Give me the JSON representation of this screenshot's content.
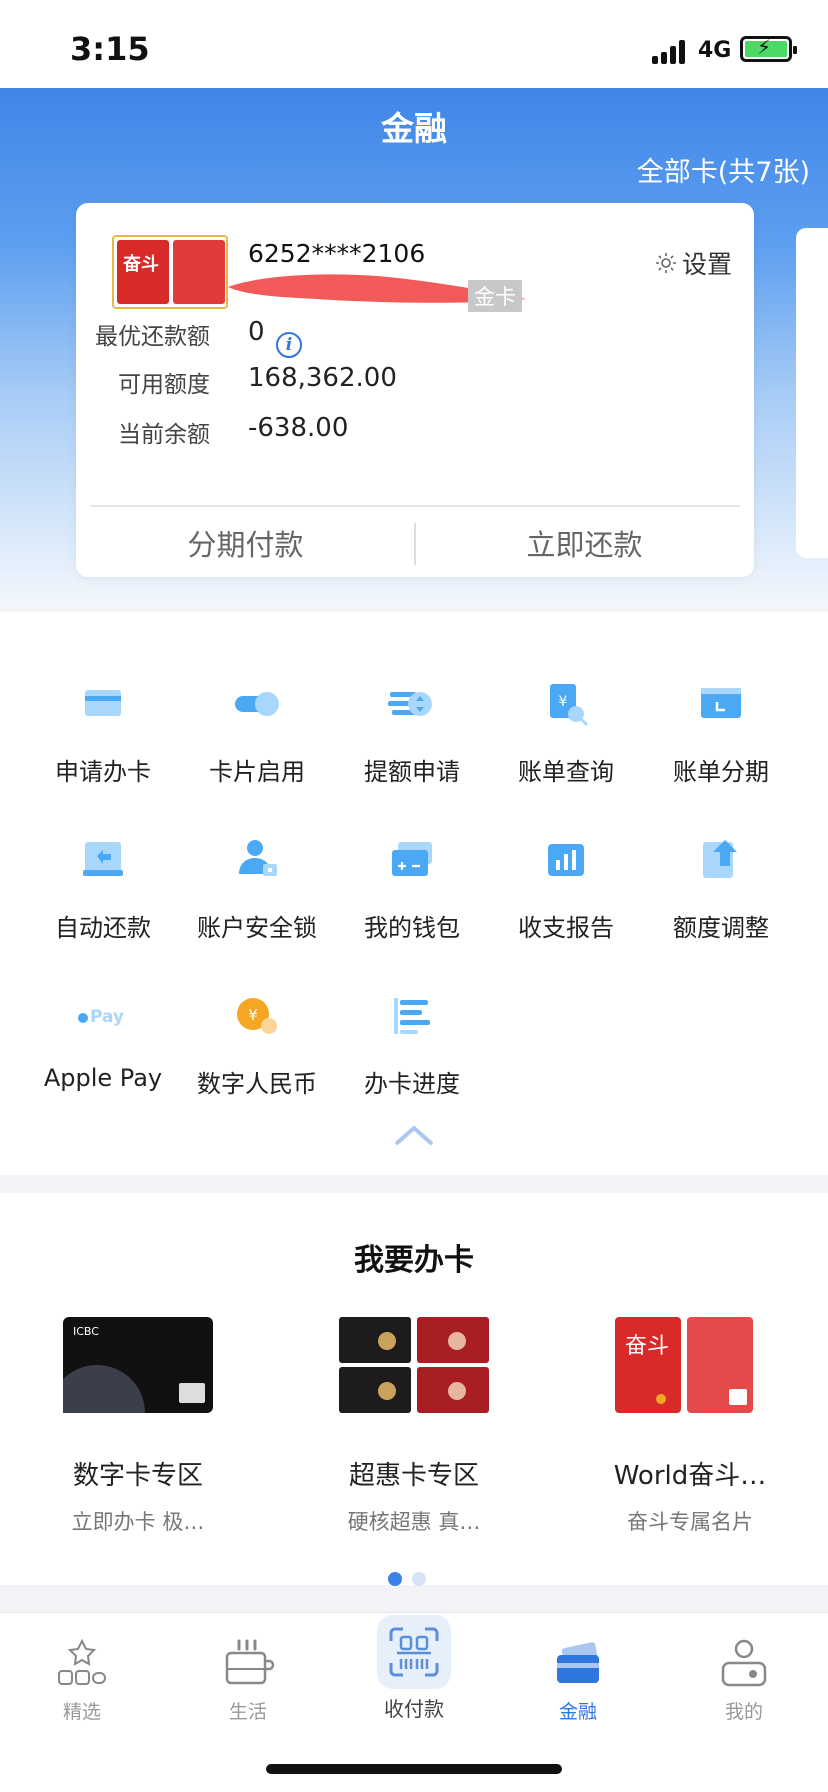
{
  "status_bar": {
    "time": "3:15",
    "network": "4G"
  },
  "header": {
    "title": "金融",
    "all_cards": "全部卡(共7张)"
  },
  "card_panel": {
    "card_number": "6252****2106",
    "card_level": "金卡",
    "settings_label": "设置",
    "rows": [
      {
        "label": "最优还款额",
        "value": "0"
      },
      {
        "label": "可用额度",
        "value": "168,362.00"
      },
      {
        "label": "当前余额",
        "value": "-638.00"
      }
    ],
    "installment_label": "分期付款",
    "repay_label": "立即还款"
  },
  "menu": {
    "items": [
      {
        "label": "申请办卡",
        "icon": "card-apply-icon"
      },
      {
        "label": "卡片启用",
        "icon": "toggle-icon"
      },
      {
        "label": "提额申请",
        "icon": "limit-up-icon"
      },
      {
        "label": "账单查询",
        "icon": "bill-search-icon"
      },
      {
        "label": "账单分期",
        "icon": "bill-installment-icon"
      },
      {
        "label": "自动还款",
        "icon": "auto-repay-icon"
      },
      {
        "label": "账户安全锁",
        "icon": "security-lock-icon"
      },
      {
        "label": "我的钱包",
        "icon": "wallet-icon"
      },
      {
        "label": "收支报告",
        "icon": "report-icon"
      },
      {
        "label": "额度调整",
        "icon": "limit-adjust-icon"
      },
      {
        "label": "Apple Pay",
        "icon": "apple-pay-icon"
      },
      {
        "label": "数字人民币",
        "icon": "digital-rmb-icon"
      },
      {
        "label": "办卡进度",
        "icon": "progress-icon"
      }
    ]
  },
  "apply": {
    "title": "我要办卡",
    "promos": [
      {
        "title": "数字卡专区",
        "subtitle": "立即办卡 极…"
      },
      {
        "title": "超惠卡专区",
        "subtitle": "硬核超惠 真…"
      },
      {
        "title": "World奋斗…",
        "subtitle": "奋斗专属名片"
      }
    ],
    "card_art_text": [
      "奋斗",
      "ICBC"
    ]
  },
  "tabs": [
    {
      "label": "精选",
      "icon": "star-grid-icon"
    },
    {
      "label": "生活",
      "icon": "coffee-icon"
    },
    {
      "label": "收付款",
      "icon": "scan-icon"
    },
    {
      "label": "金融",
      "icon": "card-icon"
    },
    {
      "label": "我的",
      "icon": "profile-icon"
    }
  ],
  "colors": {
    "accent": "#2f77de",
    "icon_blue": "#4aa8f5",
    "icon_light": "#a9d6fb",
    "orange": "#f5a623"
  }
}
